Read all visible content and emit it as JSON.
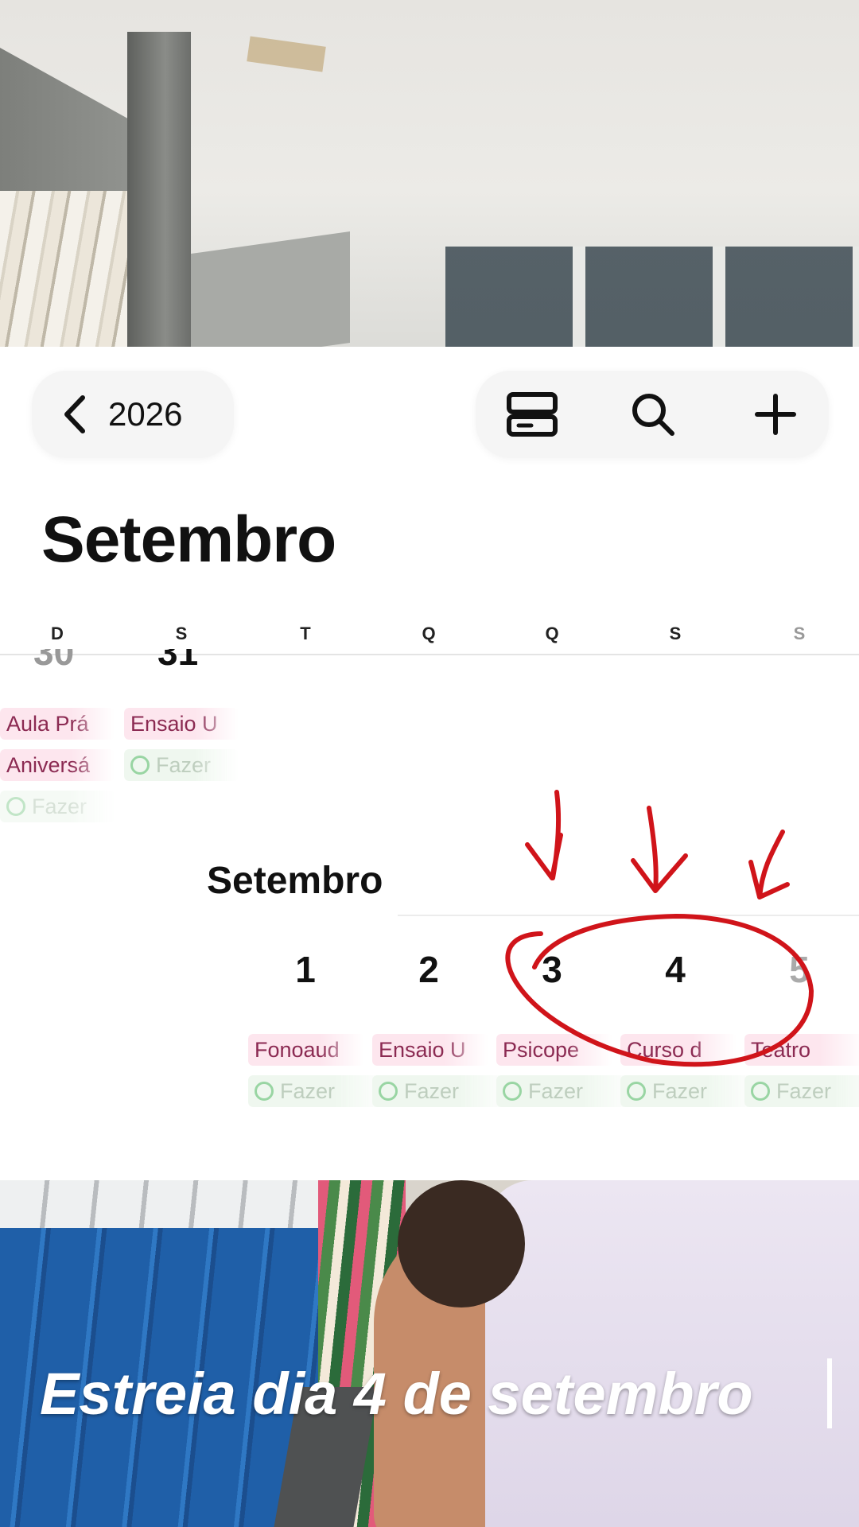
{
  "header": {
    "back_label": "2026",
    "back_icon": "chevron-left-icon",
    "actions": [
      {
        "name": "layout-toggle-icon"
      },
      {
        "name": "search-icon"
      },
      {
        "name": "add-icon"
      }
    ]
  },
  "month_title": "Setembro",
  "weekdays": [
    "D",
    "S",
    "T",
    "Q",
    "Q",
    "S",
    "S"
  ],
  "previous_week": {
    "events_day1": [
      {
        "type": "event",
        "label": "Aula Prá"
      },
      {
        "type": "event",
        "label": "Aniversá"
      },
      {
        "type": "todo",
        "label": "Fazer"
      }
    ],
    "events_day2": [
      {
        "type": "event",
        "label": "Ensaio U"
      },
      {
        "type": "todo",
        "label": "Fazer"
      }
    ]
  },
  "month_subheader": "Setembro",
  "days": [
    {
      "num": "1",
      "event": "Fonoaud",
      "todo": "Fazer"
    },
    {
      "num": "2",
      "event": "Ensaio U",
      "todo": "Fazer"
    },
    {
      "num": "3",
      "event": "Psicope",
      "todo": "Fazer"
    },
    {
      "num": "4",
      "event": "Curso d",
      "todo": "Fazer"
    },
    {
      "num": "5",
      "event": "Teatro",
      "todo": "Fazer"
    }
  ],
  "colors": {
    "event_bg": "#fde6ee",
    "event_text": "#8b2a52",
    "todo_circle": "#8fd19a",
    "annotation": "#d0141a"
  },
  "caption": "Estreia dia 4 de setembro"
}
